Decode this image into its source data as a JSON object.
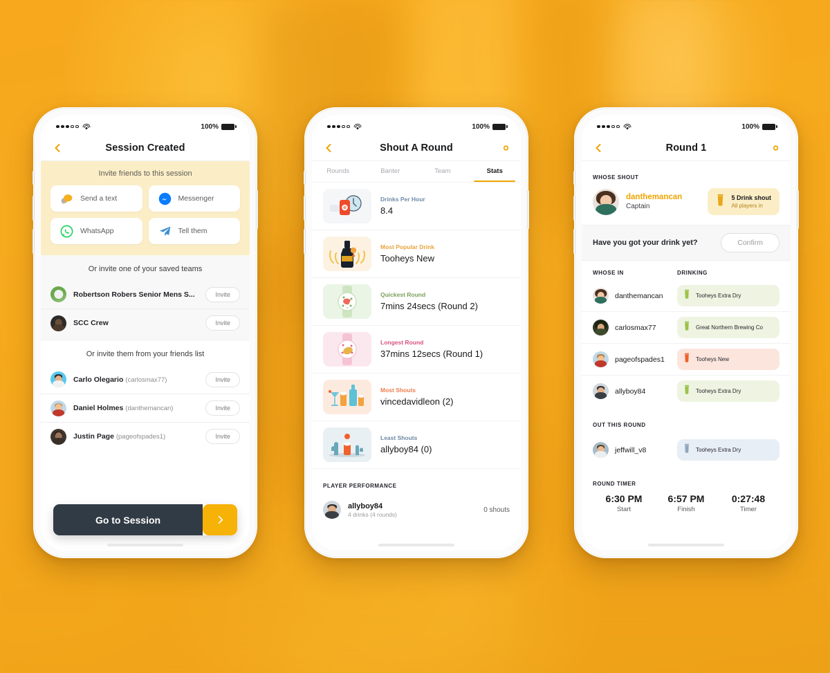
{
  "status_bar": {
    "carrier_dots_filled": 3,
    "carrier_dots_empty": 2,
    "battery_percent": "100%"
  },
  "phone_left": {
    "nav": {
      "title": "Session Created",
      "back_icon": "chevron-left-icon"
    },
    "invite": {
      "heading": "Invite friends to this session",
      "buttons": [
        {
          "label": "Send a text",
          "icon": "chat-bubble-icon",
          "color": "#f5b020"
        },
        {
          "label": "Messenger",
          "icon": "messenger-icon",
          "color": "#0a7cff"
        },
        {
          "label": "WhatsApp",
          "icon": "whatsapp-icon",
          "color": "#25d366"
        },
        {
          "label": "Tell them",
          "icon": "paper-plane-icon",
          "color": "#3d8fd1"
        }
      ]
    },
    "saved_teams": {
      "heading": "Or invite one of your saved teams",
      "invite_label": "Invite",
      "items": [
        {
          "name": "Robertson Robers Senior Mens S..."
        },
        {
          "name": "SCC Crew"
        }
      ]
    },
    "friends": {
      "heading": "Or invite them from your friends list",
      "invite_label": "Invite",
      "items": [
        {
          "name": "Carlo Olegario",
          "handle": "(carlosmax77)"
        },
        {
          "name": "Daniel Holmes",
          "handle": "(danthemancan)"
        },
        {
          "name": "Justin Page",
          "handle": "(pageofspades1)"
        }
      ]
    },
    "cta": {
      "label": "Go to Session",
      "arrow_icon": "chevron-right-icon"
    }
  },
  "phone_mid": {
    "nav": {
      "title": "Shout A Round",
      "back_icon": "chevron-left-icon",
      "settings_icon": "gear-icon"
    },
    "tabs": [
      {
        "label": "Rounds",
        "active": false
      },
      {
        "label": "Banter",
        "active": false
      },
      {
        "label": "Team",
        "active": false
      },
      {
        "label": "Stats",
        "active": true
      }
    ],
    "stats": [
      {
        "label": "Drinks Per Hour",
        "value": "8.4",
        "label_color": "#6f8aa6",
        "tile_bg": "#f4f6f8",
        "icon": "clock-drink-icon"
      },
      {
        "label": "Most Popular Drink",
        "value": "Tooheys New",
        "label_color": "#e8a33d",
        "tile_bg": "#fdf2e2",
        "icon": "trophy-bottle-icon"
      },
      {
        "label": "Quickest Round",
        "value": "7mins 24secs (Round 2)",
        "label_color": "#7ba05b",
        "tile_bg": "#eaf5e6",
        "icon": "fast-watch-icon"
      },
      {
        "label": "Longest Round",
        "value": "37mins 12secs (Round 1)",
        "label_color": "#d9527e",
        "tile_bg": "#fbe8ee",
        "icon": "slow-watch-icon"
      },
      {
        "label": "Most Shouts",
        "value": "vincedavidleon (2)",
        "label_color": "#ef7d4d",
        "tile_bg": "#fdeadf",
        "icon": "drinks-tray-icon"
      },
      {
        "label": "Least Shouts",
        "value": "allyboy84 (0)",
        "label_color": "#6f8aa6",
        "tile_bg": "#e9f0f4",
        "icon": "desert-cactus-icon"
      }
    ],
    "performance": {
      "heading": "PLAYER PERFORMANCE",
      "rows": [
        {
          "name": "allyboy84",
          "sub": "4 drinks (4 rounds)",
          "right": "0 shouts"
        }
      ]
    }
  },
  "phone_right": {
    "nav": {
      "title": "Round 1",
      "back_icon": "chevron-left-icon",
      "settings_icon": "gear-icon"
    },
    "whose_shout": {
      "heading": "WHOSE SHOUT",
      "name": "danthemancan",
      "role": "Captain",
      "badge_title": "5 Drink shout",
      "badge_sub": "All players in",
      "badge_icon": "beer-glass-icon"
    },
    "confirm": {
      "question": "Have you got your drink yet?",
      "button": "Confirm"
    },
    "columns": {
      "left": "WHOSE IN",
      "right": "DRINKING"
    },
    "players_in": [
      {
        "name": "danthemancan",
        "drink": "Tooheys Extra Dry",
        "chip_bg": "#eef4e1",
        "glass": "#9bc24a"
      },
      {
        "name": "carlosmax77",
        "drink": "Great Northern Brewing Co",
        "chip_bg": "#eef4e1",
        "glass": "#9bc24a"
      },
      {
        "name": "pageofspades1",
        "drink": "Tooheys New",
        "chip_bg": "#fbe5dc",
        "glass": "#f0622c"
      },
      {
        "name": "allyboy84",
        "drink": "Tooheys Extra Dry",
        "chip_bg": "#eef4e1",
        "glass": "#9bc24a"
      }
    ],
    "out_this_round": {
      "heading": "OUT THIS ROUND",
      "items": [
        {
          "name": "jeffwill_v8",
          "drink": "Tooheys Extra Dry",
          "chip_bg": "#e8eef5",
          "glass": "#8fa6bd"
        }
      ]
    },
    "round_timer": {
      "heading": "ROUND TIMER",
      "cells": [
        {
          "value": "6:30 PM",
          "label": "Start"
        },
        {
          "value": "6:57 PM",
          "label": "Finish"
        },
        {
          "value": "0:27:48",
          "label": "Timer"
        }
      ]
    }
  },
  "theme": {
    "accent": "#f0a400",
    "dark": "#313b45",
    "cream": "#fbeec6"
  }
}
